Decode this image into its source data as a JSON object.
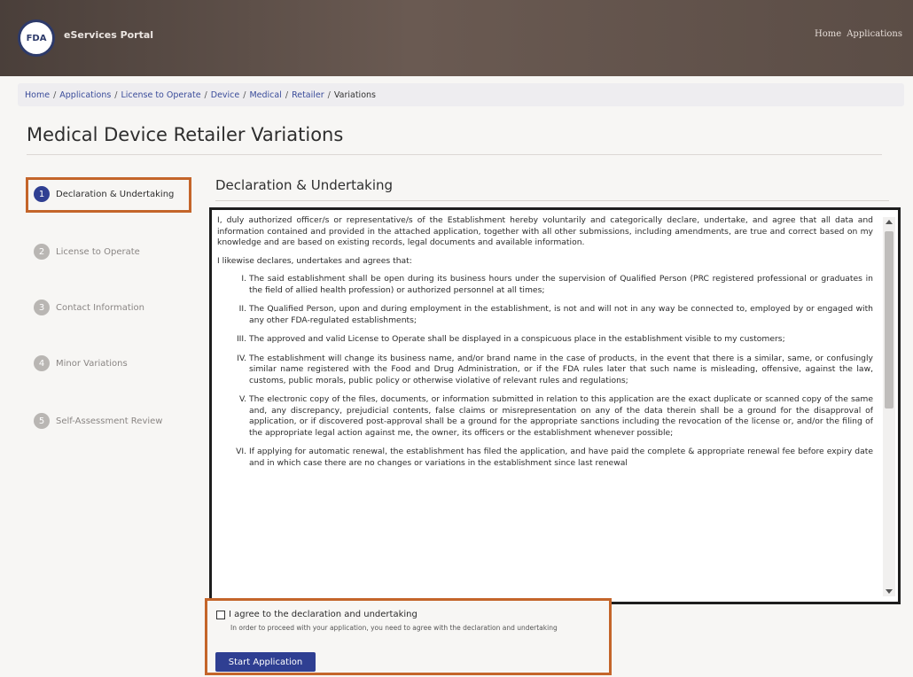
{
  "header": {
    "logo_text": "FDA",
    "portal_title": "eServices Portal",
    "nav": [
      {
        "label": "Home"
      },
      {
        "label": "Applications"
      }
    ]
  },
  "breadcrumb": [
    "Home",
    "Applications",
    "License to Operate",
    "Device",
    "Medical",
    "Retailer",
    "Variations"
  ],
  "page_title": "Medical Device Retailer Variations",
  "steps": [
    {
      "number": "1",
      "label": "Declaration & Undertaking",
      "active": true
    },
    {
      "number": "2",
      "label": "License to Operate",
      "active": false
    },
    {
      "number": "3",
      "label": "Contact Information",
      "active": false
    },
    {
      "number": "4",
      "label": "Minor Variations",
      "active": false
    },
    {
      "number": "5",
      "label": "Self-Assessment Review",
      "active": false
    }
  ],
  "section_title": "Declaration & Undertaking",
  "declaration": {
    "intro": "I, duly authorized officer/s or representative/s of the Establishment hereby voluntarily and categorically declare, undertake, and agree that all data and information contained and provided in the attached application, together with all other submissions, including amendments, are true and correct based on my knowledge and are based on existing records, legal documents and available information.",
    "likewise": "I likewise declares, undertakes and agrees that:",
    "items": [
      {
        "num": "I.",
        "text": "The said establishment shall be open during its business hours under the supervision of Qualified Person (PRC registered professional or graduates in the field of allied health profession) or authorized personnel at all times;"
      },
      {
        "num": "II.",
        "text": "The Qualified Person, upon and during employment in the establishment, is not and will not in any way be connected to, employed by or engaged with any other FDA-regulated establishments;"
      },
      {
        "num": "III.",
        "text": "The approved and valid License to Operate shall be displayed in a conspicuous place in the establishment visible to my customers;"
      },
      {
        "num": "IV.",
        "text": "The establishment will change its business name, and/or brand name in the case of products, in the event that there is a similar, same, or confusingly similar name registered with the Food and Drug Administration, or if the FDA rules later that such name is misleading, offensive, against the law, customs, public morals, public policy or otherwise violative of relevant rules and regulations;"
      },
      {
        "num": "V.",
        "text": "The electronic copy of the files, documents, or information submitted in relation to this application are the exact duplicate or scanned copy of the same and, any discrepancy, prejudicial contents, false claims or misrepresentation on any of the data therein shall be a ground for the disapproval of application, or if discovered post-approval shall be a ground for the appropriate sanctions including the revocation of the license or, and/or the filing of the appropriate legal action against me, the owner, its officers or the establishment whenever possible;"
      },
      {
        "num": "VI.",
        "text": "If applying for automatic renewal, the establishment has filed the application, and have paid the complete & appropriate renewal fee before expiry date and in which case there are no changes or variations in the establishment since last renewal"
      }
    ]
  },
  "agree": {
    "label": "I agree to the declaration and undertaking",
    "hint": "In order to proceed with your application, you need to agree with the declaration and undertaking",
    "checked": false
  },
  "start_button": "Start Application",
  "colors": {
    "accent": "#2f3f92",
    "highlight_box": "#c4652a",
    "header": "#5b4d46"
  }
}
